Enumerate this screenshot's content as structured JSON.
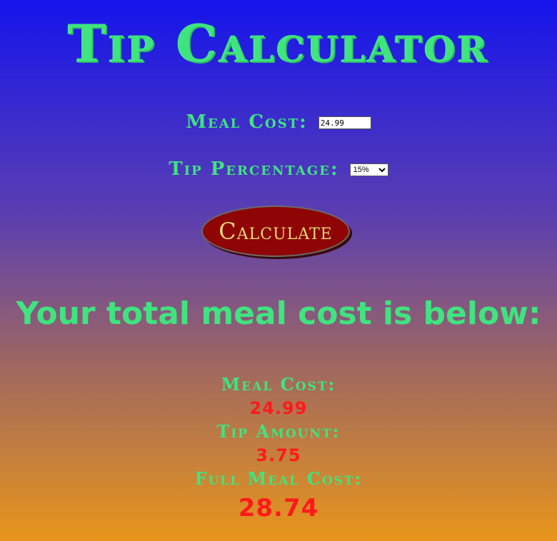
{
  "header": {
    "title": "Tip Calculator"
  },
  "form": {
    "meal_cost_label": "Meal Cost:",
    "meal_cost_value": "24.99",
    "tip_percentage_label": "Tip Percentage:",
    "tip_percentage_selected": "15%",
    "calculate_label": "Calculate"
  },
  "results": {
    "heading": "Your total meal cost is below:",
    "meal_cost_label": "Meal Cost:",
    "meal_cost_value": "24.99",
    "tip_amount_label": "Tip Amount:",
    "tip_amount_value": "3.75",
    "full_meal_cost_label": "Full Meal Cost:",
    "full_meal_cost_value": "28.74"
  },
  "colors": {
    "label_green": "#3fe47f",
    "value_red": "#ff1a1a",
    "button_bg": "#8f0505",
    "button_text": "#e9d87a"
  }
}
